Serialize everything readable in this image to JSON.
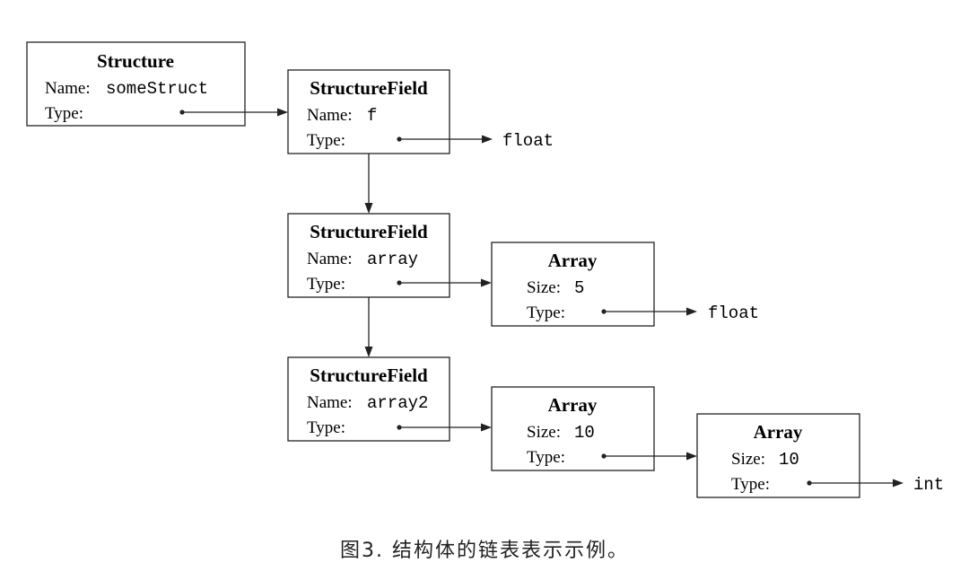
{
  "nodes": {
    "structure": {
      "title": "Structure",
      "name_label": "Name:",
      "name_value": "someStruct",
      "type_label": "Type:"
    },
    "field1": {
      "title": "StructureField",
      "name_label": "Name:",
      "name_value": "f",
      "type_label": "Type:"
    },
    "field2": {
      "title": "StructureField",
      "name_label": "Name:",
      "name_value": "array",
      "type_label": "Type:"
    },
    "field3": {
      "title": "StructureField",
      "name_label": "Name:",
      "name_value": "array2",
      "type_label": "Type:"
    },
    "array1": {
      "title": "Array",
      "size_label": "Size:",
      "size_value": "5",
      "type_label": "Type:"
    },
    "array2": {
      "title": "Array",
      "size_label": "Size:",
      "size_value": "10",
      "type_label": "Type:"
    },
    "array3": {
      "title": "Array",
      "size_label": "Size:",
      "size_value": "10",
      "type_label": "Type:"
    }
  },
  "types": {
    "field1_type": "float",
    "array1_type": "float",
    "array3_type": "int"
  },
  "caption": "图3. 结构体的链表表示示例。"
}
